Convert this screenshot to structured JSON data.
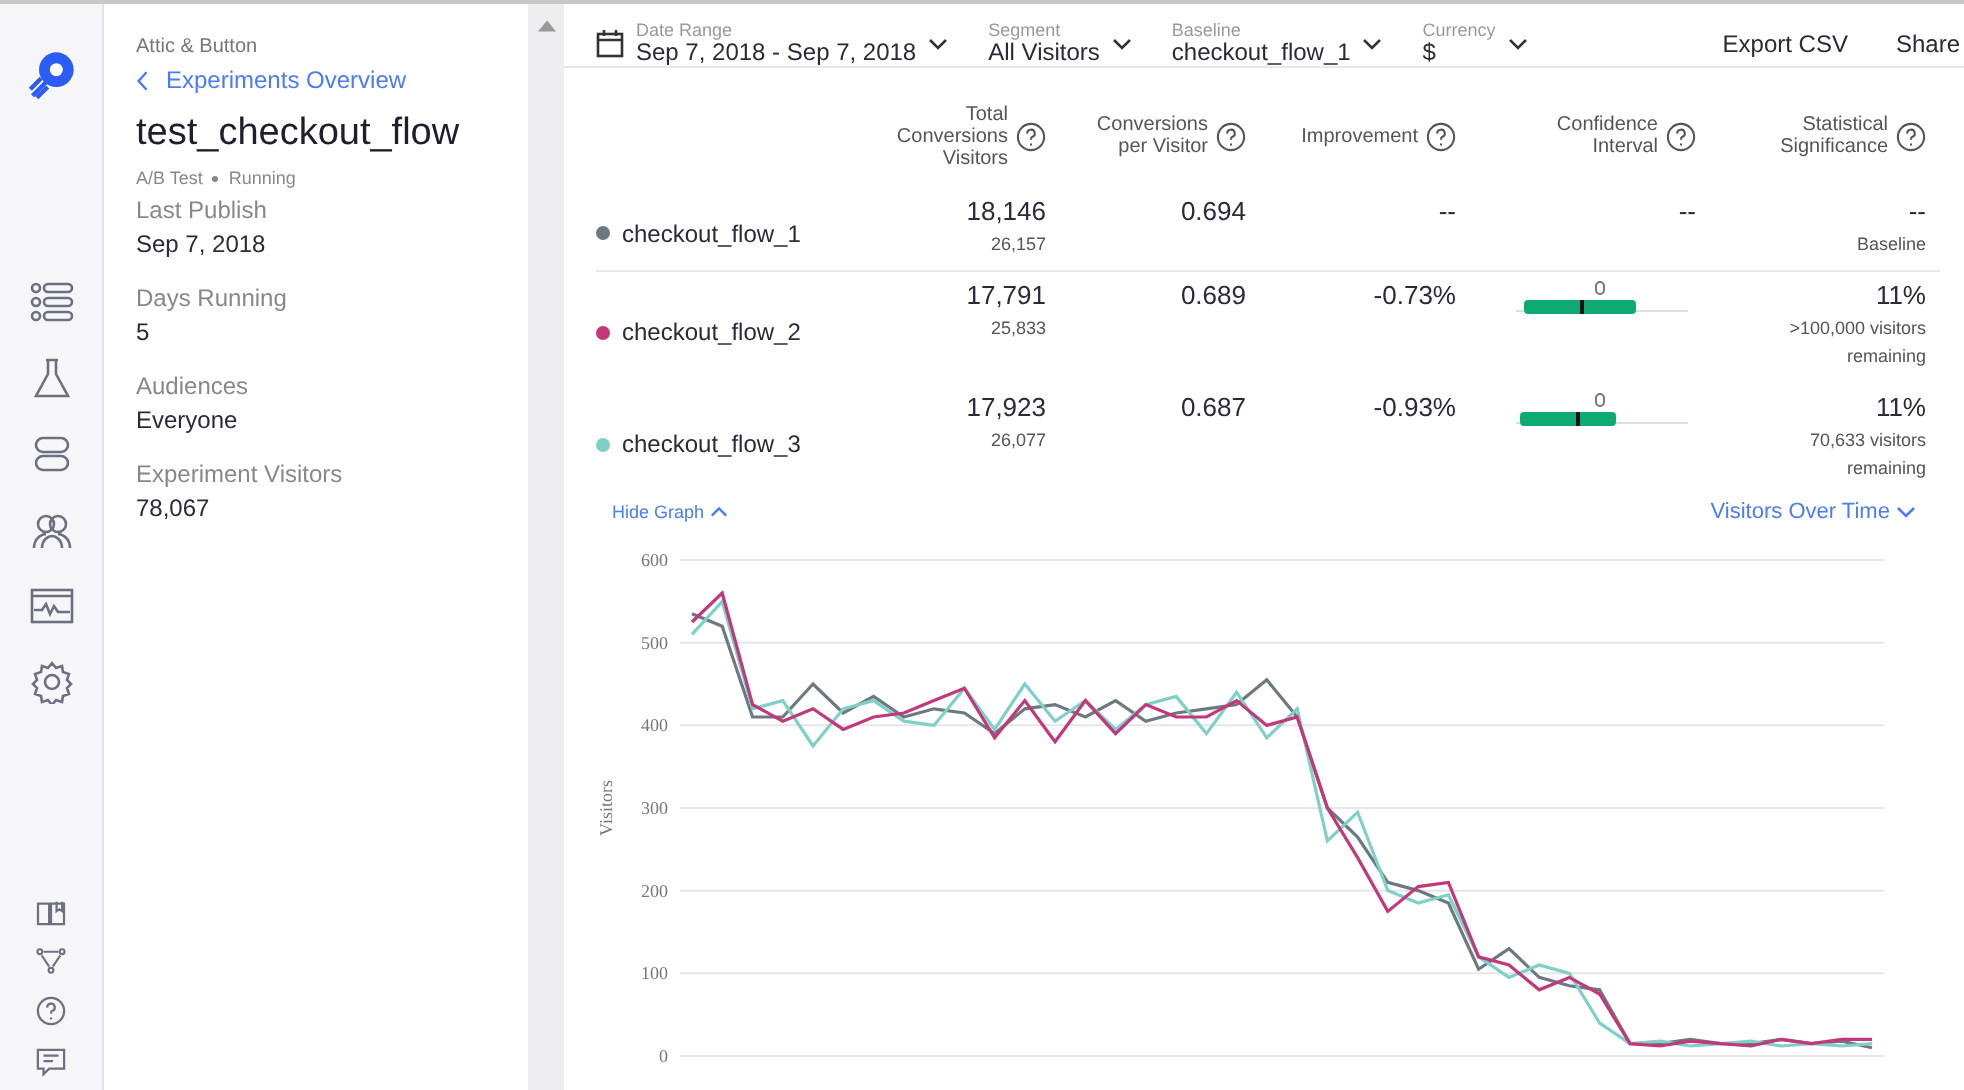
{
  "project": {
    "name": "Attic & Button",
    "back_link": "Experiments Overview",
    "title": "test_checkout_flow",
    "type": "A/B Test",
    "status": "Running",
    "details": [
      {
        "label": "Last Publish",
        "value": "Sep 7, 2018"
      },
      {
        "label": "Days Running",
        "value": "5"
      },
      {
        "label": "Audiences",
        "value": "Everyone"
      },
      {
        "label": "Experiment Visitors",
        "value": "78,067"
      }
    ]
  },
  "filters": [
    {
      "label": "Date Range",
      "value": "Sep 7, 2018 - Sep 7, 2018",
      "kind": "date"
    },
    {
      "label": "Segment",
      "value": "All Visitors",
      "kind": "select"
    },
    {
      "label": "Baseline",
      "value": "checkout_flow_1",
      "kind": "select"
    },
    {
      "label": "Currency",
      "value": "$",
      "kind": "select"
    }
  ],
  "actions": [
    "Export CSV",
    "Share"
  ],
  "table": {
    "columns": [
      {
        "lines": [
          "Total",
          "Conversions",
          "Visitors"
        ]
      },
      {
        "lines": [
          "Conversions",
          "per Visitor"
        ]
      },
      {
        "lines": [
          "Improvement"
        ]
      },
      {
        "lines": [
          "Confidence",
          "Interval"
        ]
      },
      {
        "lines": [
          "Statistical",
          "Significance"
        ]
      }
    ],
    "rows": [
      {
        "name": "checkout_flow_1",
        "color": "#6c7a80",
        "conversions": "18,146",
        "visitors": "26,157",
        "per_visitor": "0.694",
        "improvement": "--",
        "interval": "--",
        "significance": "--",
        "note": [
          "Baseline"
        ]
      },
      {
        "name": "checkout_flow_2",
        "color": "#c2387a",
        "conversions": "17,791",
        "visitors": "25,833",
        "per_visitor": "0.689",
        "improvement": "-0.73%",
        "interval_bar": true,
        "significance": "11%",
        "note": [
          ">100,000 visitors",
          "remaining"
        ]
      },
      {
        "name": "checkout_flow_3",
        "color": "#7fd0c8",
        "conversions": "17,923",
        "visitors": "26,077",
        "per_visitor": "0.687",
        "improvement": "-0.93%",
        "interval_bar": true,
        "significance": "11%",
        "note": [
          "70,633 visitors",
          "remaining"
        ]
      }
    ]
  },
  "graph_toggle": "Hide Graph",
  "graph_metric": "Visitors Over Time",
  "chart_data": {
    "type": "line",
    "grid": true,
    "ylabel": "Visitors",
    "ylim": [
      0,
      600
    ],
    "yticks": [
      0,
      100,
      200,
      300,
      400,
      500,
      600
    ],
    "series": [
      {
        "color": "#6c7a80",
        "values": [
          535,
          520,
          410,
          410,
          450,
          415,
          435,
          410,
          420,
          415,
          390,
          420,
          425,
          410,
          430,
          405,
          415,
          420,
          425,
          455,
          410,
          300,
          265,
          210,
          200,
          185,
          105,
          130,
          95,
          85,
          80,
          15,
          15,
          20,
          15,
          15,
          20,
          15,
          18,
          10
        ]
      },
      {
        "color": "#7fd0c8",
        "values": [
          510,
          550,
          420,
          430,
          375,
          420,
          430,
          405,
          400,
          445,
          395,
          450,
          405,
          430,
          395,
          425,
          435,
          390,
          440,
          385,
          420,
          260,
          295,
          200,
          185,
          195,
          120,
          95,
          110,
          100,
          40,
          15,
          18,
          12,
          15,
          18,
          12,
          15,
          12,
          15
        ]
      },
      {
        "color": "#c2387a",
        "values": [
          525,
          560,
          425,
          405,
          420,
          395,
          410,
          415,
          430,
          445,
          385,
          430,
          380,
          430,
          390,
          425,
          410,
          410,
          430,
          400,
          410,
          300,
          240,
          175,
          205,
          210,
          120,
          110,
          80,
          95,
          75,
          15,
          12,
          18,
          15,
          12,
          20,
          15,
          20,
          20
        ]
      }
    ]
  }
}
